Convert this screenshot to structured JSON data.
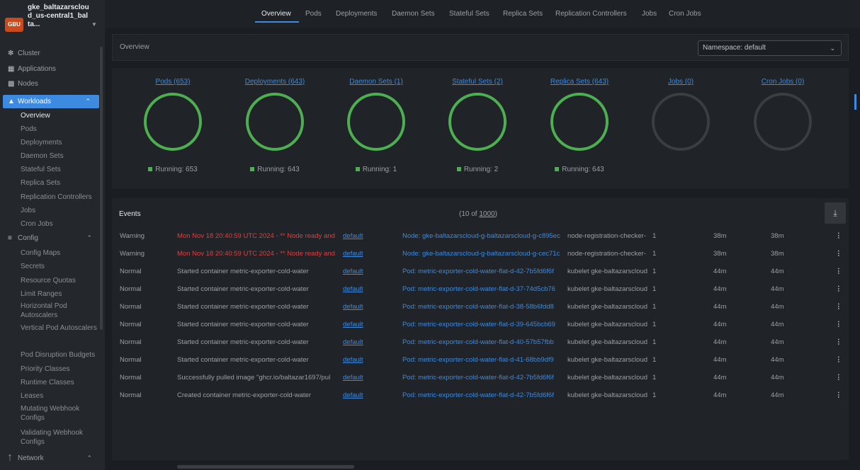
{
  "cluster": {
    "avatar": "GBU",
    "name": "gke_baltazarscloud_us-central1_balta..."
  },
  "sidebar": {
    "top": [
      {
        "label": "Cluster"
      },
      {
        "label": "Applications"
      },
      {
        "label": "Nodes"
      }
    ],
    "workloads": {
      "label": "Workloads",
      "items": [
        "Overview",
        "Pods",
        "Deployments",
        "Daemon Sets",
        "Stateful Sets",
        "Replica Sets",
        "Replication Controllers",
        "Jobs",
        "Cron Jobs"
      ]
    },
    "config": {
      "label": "Config",
      "items": [
        "Config Maps",
        "Secrets",
        "Resource Quotas",
        "Limit Ranges",
        "Horizontal Pod Autoscalers",
        "Vertical Pod Autoscalers",
        "Pod Disruption Budgets",
        "Priority Classes",
        "Runtime Classes",
        "Leases",
        "Mutating Webhook Configs",
        "Validating Webhook Configs"
      ]
    },
    "network": {
      "label": "Network"
    }
  },
  "tabs": [
    "Overview",
    "Pods",
    "Deployments",
    "Daemon Sets",
    "Stateful Sets",
    "Replica Sets",
    "Replication Controllers",
    "Jobs",
    "Cron Jobs"
  ],
  "overview": {
    "title": "Overview",
    "namespace": "Namespace: default"
  },
  "charts": [
    {
      "label": "Pods (653)",
      "legend": "Running: 653",
      "filled": true
    },
    {
      "label": "Deployments (643)",
      "legend": "Running: 643",
      "filled": true
    },
    {
      "label": "Daemon Sets (1)",
      "legend": "Running: 1",
      "filled": true
    },
    {
      "label": "Stateful Sets (2)",
      "legend": "Running: 2",
      "filled": true
    },
    {
      "label": "Replica Sets (643)",
      "legend": "Running: 643",
      "filled": true
    },
    {
      "label": "Jobs (0)",
      "legend": "",
      "filled": false
    },
    {
      "label": "Cron Jobs (0)",
      "legend": "",
      "filled": false
    }
  ],
  "colors": {
    "running": "#4caf50",
    "empty": "#3a3d42",
    "accent": "#3d8be0",
    "warning": "#e23f3f"
  },
  "events": {
    "title": "Events",
    "count_prefix": "(10 of ",
    "count_total": "1000",
    "count_suffix": ")",
    "rows": [
      {
        "type": "Warning",
        "message": "Mon Nov 18 20:40:59 UTC 2024 - ** Node ready and",
        "namespace": "default",
        "object": "Node: gke-baltazarscloud-g-baltazarscloud-g-c895ec",
        "source": "node-registration-checker-",
        "count": "1",
        "first": "38m",
        "last": "38m"
      },
      {
        "type": "Warning",
        "message": "Mon Nov 18 20:40:59 UTC 2024 - ** Node ready and",
        "namespace": "default",
        "object": "Node: gke-baltazarscloud-g-baltazarscloud-g-cec71c",
        "source": "node-registration-checker-",
        "count": "1",
        "first": "38m",
        "last": "38m"
      },
      {
        "type": "Normal",
        "message": "Started container metric-exporter-cold-water",
        "namespace": "default",
        "object": "Pod: metric-exporter-cold-water-flat-d-42-7b5fd6f6f",
        "source": "kubelet gke-baltazarscloud",
        "count": "1",
        "first": "44m",
        "last": "44m"
      },
      {
        "type": "Normal",
        "message": "Started container metric-exporter-cold-water",
        "namespace": "default",
        "object": "Pod: metric-exporter-cold-water-flat-d-37-74d5cb76",
        "source": "kubelet gke-baltazarscloud",
        "count": "1",
        "first": "44m",
        "last": "44m"
      },
      {
        "type": "Normal",
        "message": "Started container metric-exporter-cold-water",
        "namespace": "default",
        "object": "Pod: metric-exporter-cold-water-flat-d-38-58b6fdd8",
        "source": "kubelet gke-baltazarscloud",
        "count": "1",
        "first": "44m",
        "last": "44m"
      },
      {
        "type": "Normal",
        "message": "Started container metric-exporter-cold-water",
        "namespace": "default",
        "object": "Pod: metric-exporter-cold-water-flat-d-39-645bcb69",
        "source": "kubelet gke-baltazarscloud",
        "count": "1",
        "first": "44m",
        "last": "44m"
      },
      {
        "type": "Normal",
        "message": "Started container metric-exporter-cold-water",
        "namespace": "default",
        "object": "Pod: metric-exporter-cold-water-flat-d-40-57b57fbb",
        "source": "kubelet gke-baltazarscloud",
        "count": "1",
        "first": "44m",
        "last": "44m"
      },
      {
        "type": "Normal",
        "message": "Started container metric-exporter-cold-water",
        "namespace": "default",
        "object": "Pod: metric-exporter-cold-water-flat-d-41-68bb9df9",
        "source": "kubelet gke-baltazarscloud",
        "count": "1",
        "first": "44m",
        "last": "44m"
      },
      {
        "type": "Normal",
        "message": "Successfully pulled image \"ghcr.io/baltazar1697/pul",
        "namespace": "default",
        "object": "Pod: metric-exporter-cold-water-flat-d-42-7b5fd6f6f",
        "source": "kubelet gke-baltazarscloud",
        "count": "1",
        "first": "44m",
        "last": "44m"
      },
      {
        "type": "Normal",
        "message": "Created container metric-exporter-cold-water",
        "namespace": "default",
        "object": "Pod: metric-exporter-cold-water-flat-d-42-7b5fd6f6f",
        "source": "kubelet gke-baltazarscloud",
        "count": "1",
        "first": "44m",
        "last": "44m"
      }
    ]
  }
}
